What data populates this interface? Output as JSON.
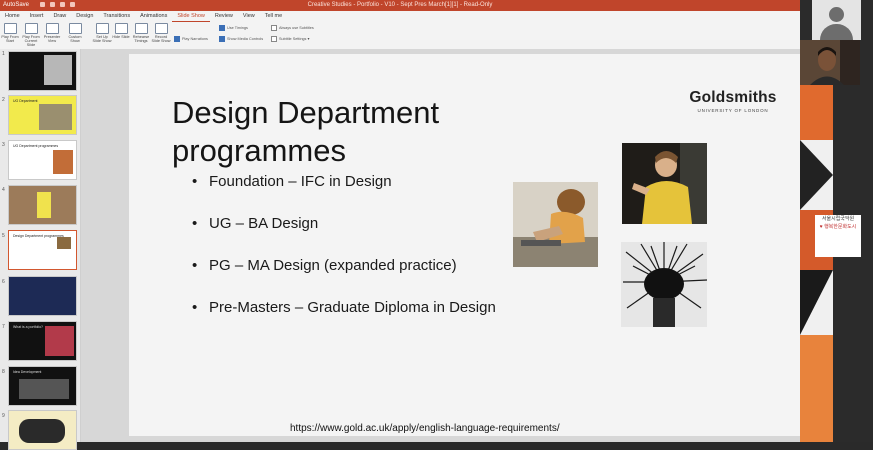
{
  "titlebar": {
    "autosave": "AutoSave",
    "doc_title": "Creative Studies - Portfolio - V10 - Sept Pres March[1][1] - Read-Only"
  },
  "tabs": [
    "Home",
    "Insert",
    "Draw",
    "Design",
    "Transitions",
    "Animations",
    "Slide Show",
    "Review",
    "View",
    "Tell me"
  ],
  "active_tab": "Slide Show",
  "ribbon": {
    "buttons": [
      "Play From Start",
      "Play From Current Slide",
      "Presenter View",
      "Custom Show",
      "Set Up Slide Show",
      "Hide Slide",
      "Rehearse Timings",
      "Record Slide Show"
    ],
    "checks": {
      "use_timings": "Use Timings",
      "play_narrations": "Play Narrations",
      "show_media_controls": "Show Media Controls",
      "always_subtitles": "Always use Subtitles",
      "subtitle_settings": "Subtitle Settings"
    }
  },
  "thumbs": {
    "numbers": [
      "1",
      "2",
      "3",
      "4",
      "5",
      "6",
      "7",
      "8",
      "9"
    ],
    "texts": [
      "",
      "UG Department",
      "UG Department programmes",
      "",
      "Design Department programmes",
      "",
      "What is a portfolio?",
      "Idea Development",
      ""
    ]
  },
  "slide": {
    "title_line1": "Design Department",
    "title_line2": "programmes",
    "bullet_glyph": "•",
    "bullets": [
      "Foundation – IFC in Design",
      "UG – BA Design",
      "PG – MA Design (expanded practice)",
      "Pre-Masters – Graduate Diploma in Design"
    ],
    "logo_name": "Goldsmiths",
    "logo_sub": "UNIVERSITY OF LONDON",
    "url": "https://www.gold.ac.uk/apply/english-language-requirements/"
  },
  "right_panel": {
    "text_line1": "서울시립국악원",
    "text_line2": "♥ 행복한문화도시"
  }
}
